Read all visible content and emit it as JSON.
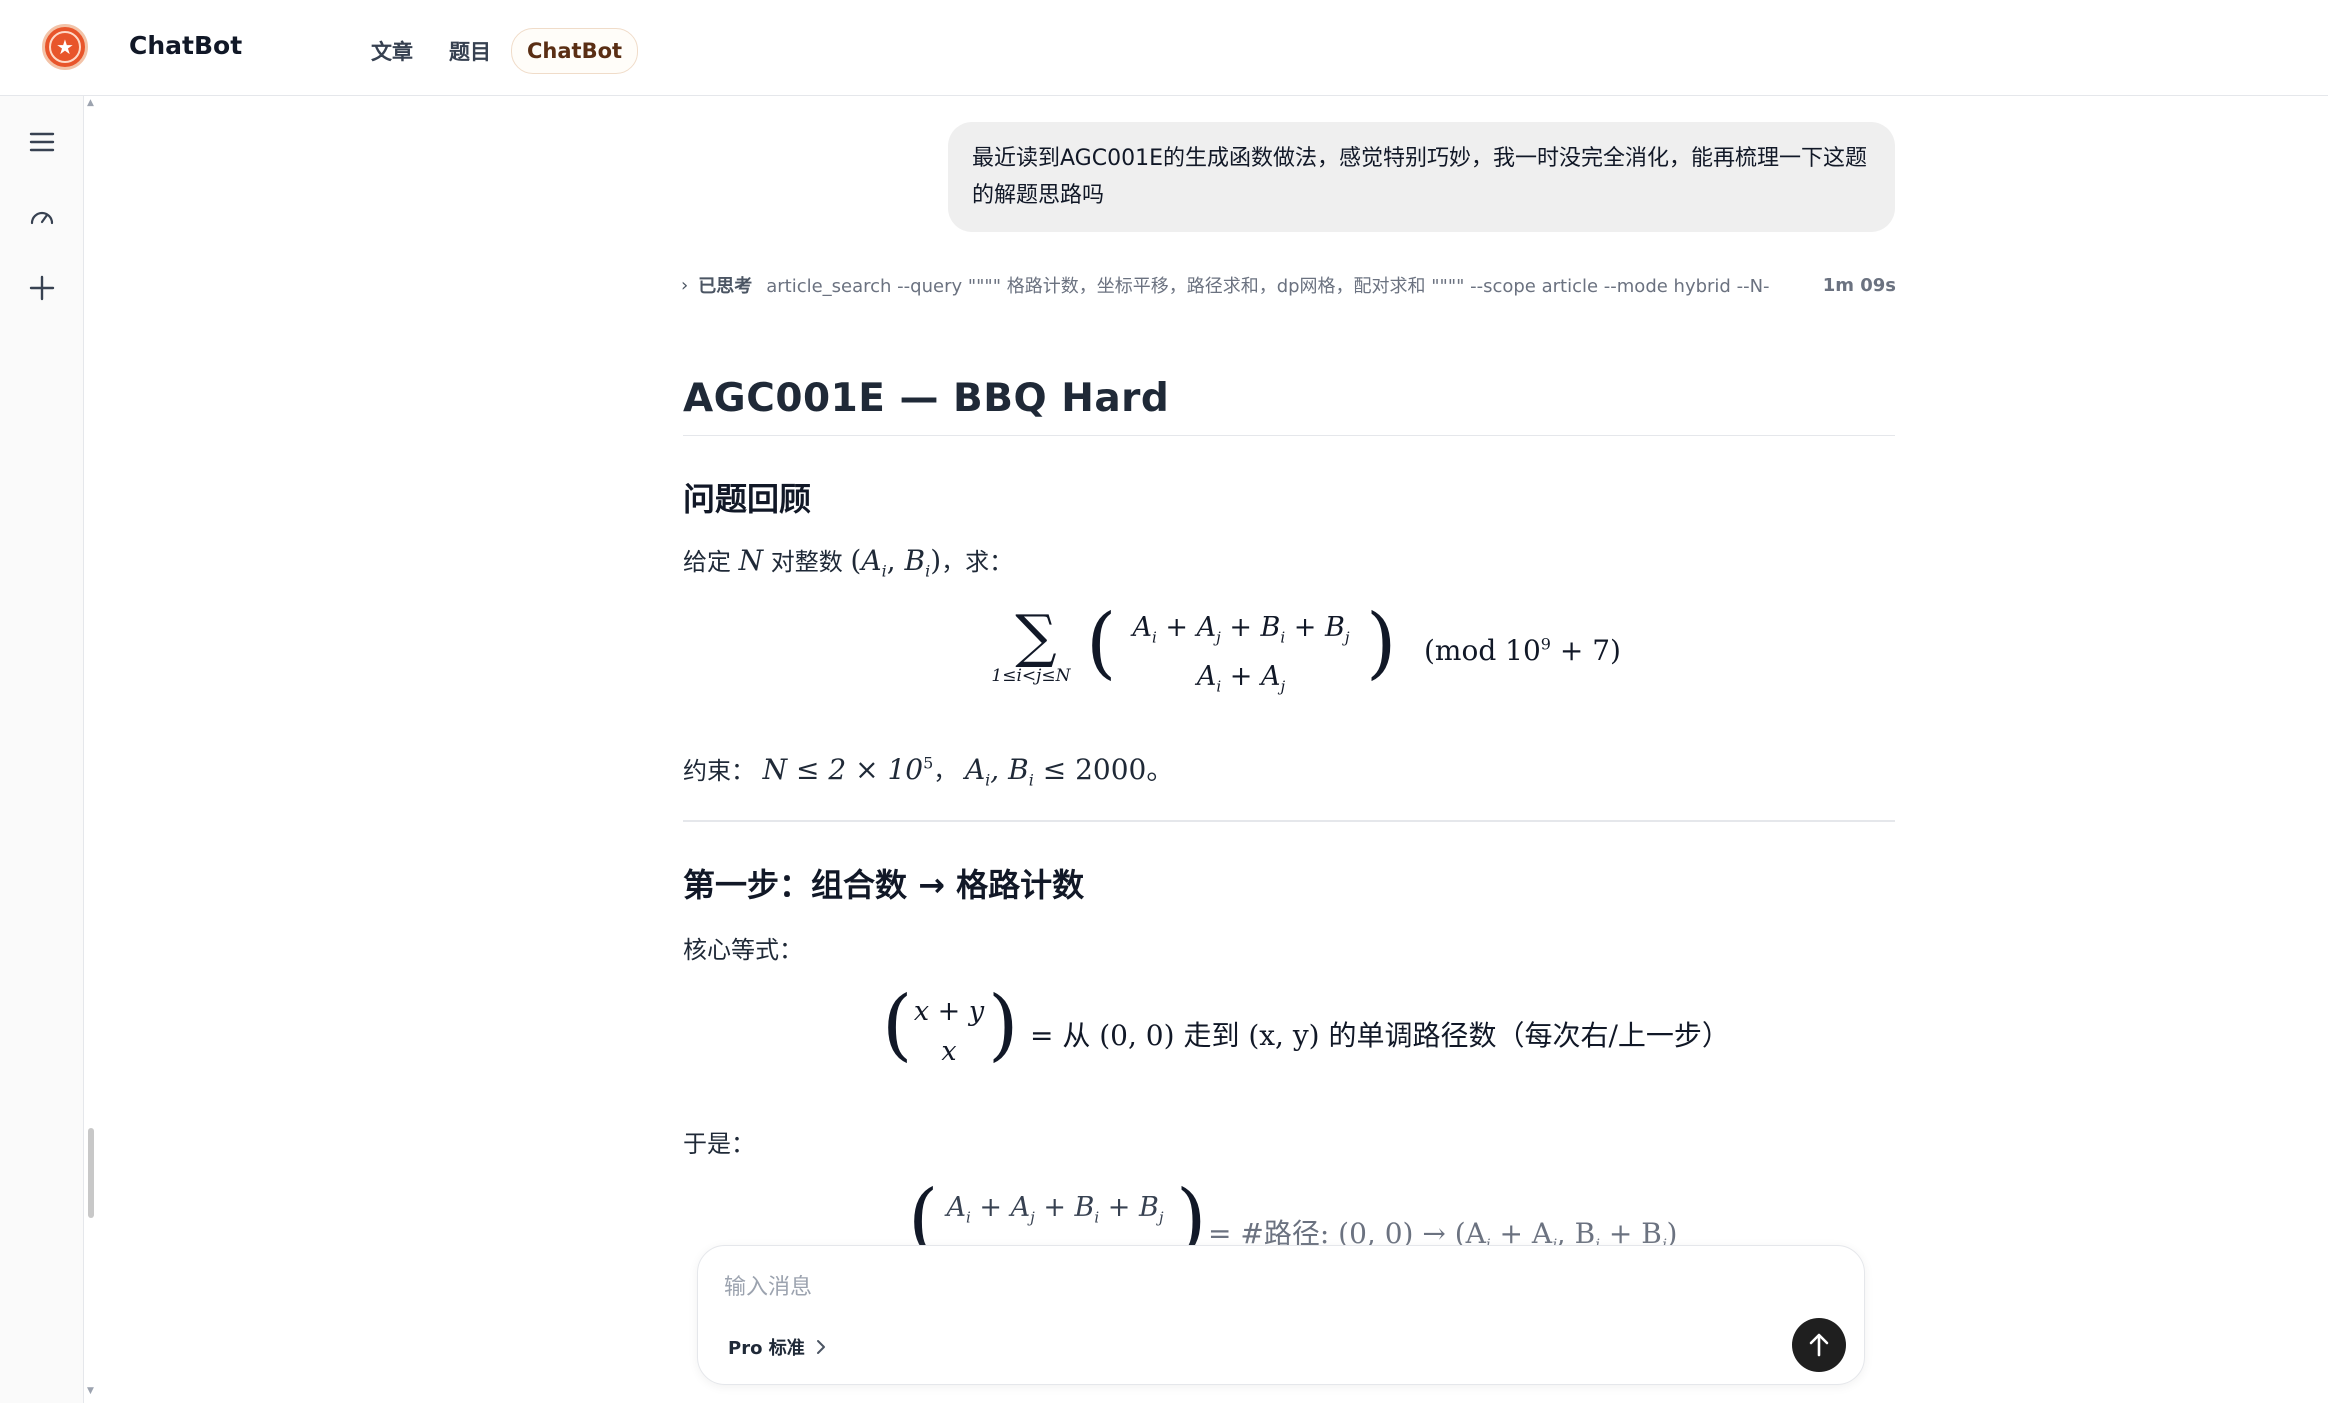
{
  "header": {
    "brand": "ChatBot",
    "nav": [
      {
        "label": "文章"
      },
      {
        "label": "题目"
      },
      {
        "label": "ChatBot"
      }
    ]
  },
  "sidebar": {
    "icons": [
      "menu-icon",
      "dashboard-gauge-icon",
      "plus-icon"
    ]
  },
  "chat": {
    "user_message": "最近读到AGC001E的生成函数做法，感觉特别巧妙，我一时没完全消化，能再梳理一下这题的解题思路吗",
    "thinking": {
      "label": "已思考",
      "query": "article_search --query \"\"\"\" 格路计数，坐标平移，路径求和，dp网格，配对求和 \"\"\"\" --scope article --mode hybrid --N-",
      "duration": "1m 09s"
    },
    "answer": {
      "title": "AGC001E — BBQ Hard",
      "section1": {
        "heading": "问题回顾",
        "intro_prefix": "给定",
        "intro_mid": "对整数",
        "intro_suffix": "，求：",
        "mod_text": "(mod 10",
        "mod_exp": "9",
        "mod_tail": " + 7)",
        "constraint_label": "约束：",
        "constraint_a": "N ≤ 2 × 10",
        "constraint_exp": "5",
        "constraint_b": "，",
        "constraint_c": "A",
        "constraint_d": ", B",
        "constraint_e": " ≤ 2000。"
      },
      "section2": {
        "heading": "第一步：组合数 → 格路计数",
        "core_label": "核心等式：",
        "eq_text": "= 从 (0, 0) 走到 (x, y) 的单调路径数（每次右/上一步）",
        "then_label": "于是：",
        "eq2_text": "= #路径: (0, 0) → (A",
        "eq2_mid": " + A",
        "eq2_mid2": ", B",
        "eq2_mid3": " + B",
        "eq2_end": ")"
      }
    }
  },
  "composer": {
    "placeholder": "输入消息",
    "model_label": "Pro 标准"
  }
}
